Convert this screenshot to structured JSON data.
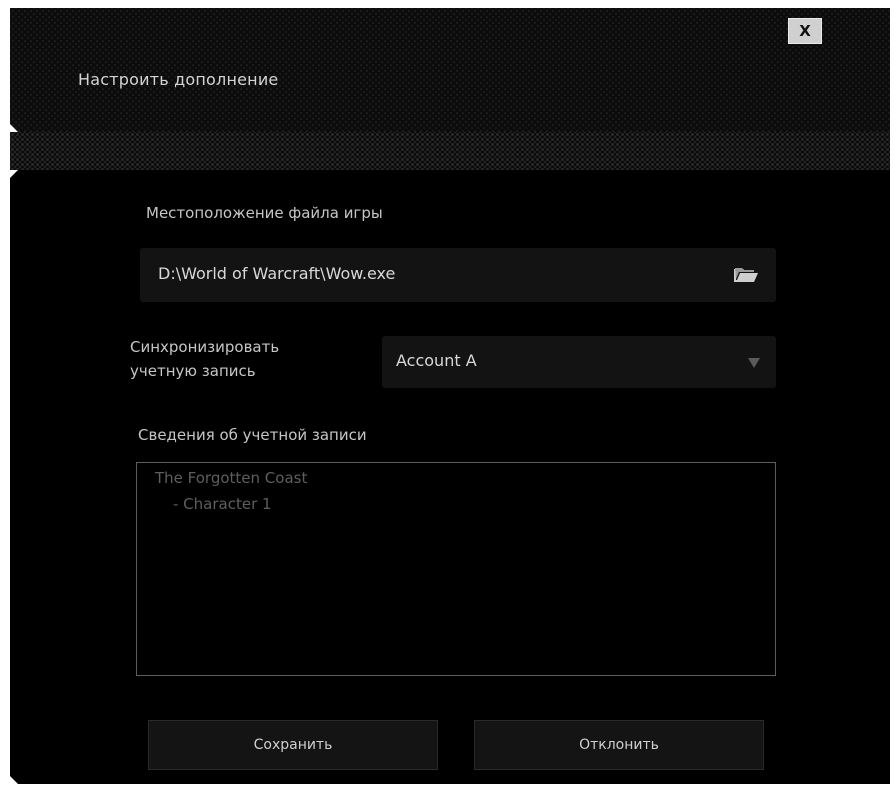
{
  "dialog": {
    "title": "Настроить дополнение",
    "close_label": "X"
  },
  "game_location": {
    "label": "Местоположение файла игры",
    "value": "D:\\World of Warcraft\\Wow.exe",
    "browse_icon": "folder-icon"
  },
  "sync_account": {
    "label_line1": "Синхронизировать",
    "label_line2": "учетную запись",
    "selected": "Account A",
    "dropdown_icon": "chevron-down-icon"
  },
  "account_info": {
    "label": "Сведения об учетной записи",
    "lines": [
      "The Forgotten Coast",
      "- Character 1"
    ]
  },
  "buttons": {
    "save": "Сохранить",
    "cancel": "Отклонить"
  },
  "colors": {
    "background": "#000000",
    "field": "#131313",
    "text": "#c8c8c8",
    "muted_text": "#5e5e5e"
  }
}
